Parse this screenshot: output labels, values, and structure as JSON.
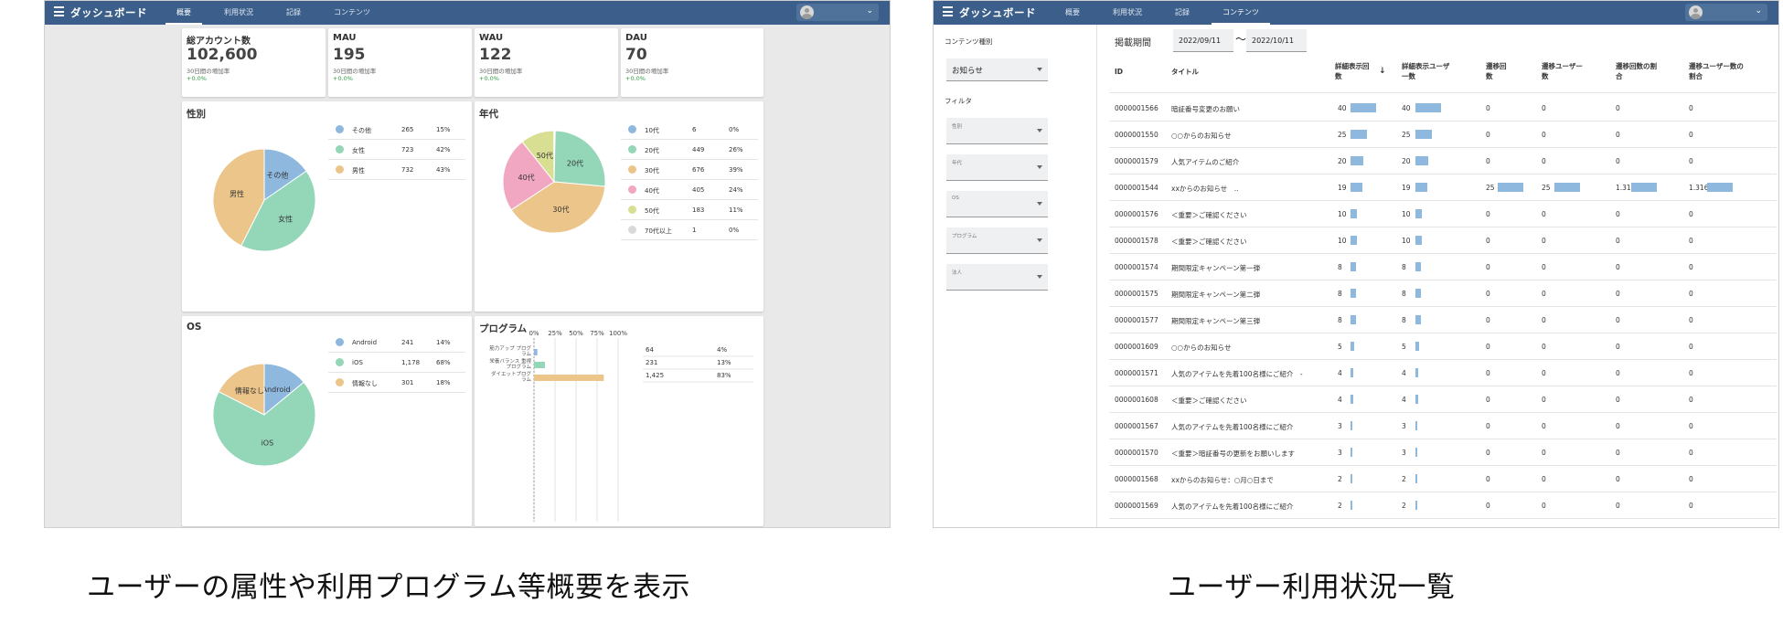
{
  "left_screen": {
    "brand": "ダッシュボード",
    "tabs": [
      "概要",
      "利用状況",
      "記録",
      "コンテンツ"
    ],
    "active_tab": 0,
    "stats": [
      {
        "label": "総アカウント数",
        "value": "102,600",
        "sub": "30日間の増加率",
        "change": "+0.0%"
      },
      {
        "label": "MAU",
        "value": "195",
        "sub": "30日間の増加率",
        "change": "+0.0%"
      },
      {
        "label": "WAU",
        "value": "122",
        "sub": "30日間の増加率",
        "change": "+0.0%"
      },
      {
        "label": "DAU",
        "value": "70",
        "sub": "30日間の増加率",
        "change": "+0.0%"
      }
    ],
    "gender": {
      "title": "性別",
      "items": [
        {
          "name": "その他",
          "count": "265",
          "pct": "15%",
          "value": 265,
          "color": "#8fb8df"
        },
        {
          "name": "女性",
          "count": "723",
          "pct": "42%",
          "value": 723,
          "color": "#93d7b8"
        },
        {
          "name": "男性",
          "count": "732",
          "pct": "43%",
          "value": 732,
          "color": "#ecc58a"
        }
      ]
    },
    "age": {
      "title": "年代",
      "items": [
        {
          "name": "10代",
          "count": "6",
          "pct": "0%",
          "value": 6,
          "color": "#8fb8df",
          "slice_label": ""
        },
        {
          "name": "20代",
          "count": "449",
          "pct": "26%",
          "value": 449,
          "color": "#93d7b8",
          "slice_label": "20代"
        },
        {
          "name": "30代",
          "count": "676",
          "pct": "39%",
          "value": 676,
          "color": "#ecc58a",
          "slice_label": "30代"
        },
        {
          "name": "40代",
          "count": "405",
          "pct": "24%",
          "value": 405,
          "color": "#f1a7c2",
          "slice_label": "40代"
        },
        {
          "name": "50代",
          "count": "183",
          "pct": "11%",
          "value": 183,
          "color": "#d8df92",
          "slice_label": "50代"
        },
        {
          "name": "70代以上",
          "count": "1",
          "pct": "0%",
          "value": 1,
          "color": "#d9d9d9",
          "slice_label": ""
        }
      ]
    },
    "os": {
      "title": "OS",
      "items": [
        {
          "name": "Android",
          "count": "241",
          "pct": "14%",
          "value": 241,
          "color": "#8fb8df"
        },
        {
          "name": "iOS",
          "count": "1,178",
          "pct": "68%",
          "value": 1178,
          "color": "#93d7b8"
        },
        {
          "name": "情報なし",
          "count": "301",
          "pct": "18%",
          "value": 301,
          "color": "#ecc58a"
        }
      ]
    },
    "program": {
      "title": "プログラム",
      "ticks": [
        "0%",
        "25%",
        "50%",
        "75%",
        "100%"
      ],
      "items": [
        {
          "name_lines": [
            "筋力アップ プログ",
            "ラム"
          ],
          "count": "64",
          "pct": "4%",
          "value": 0.04,
          "color": "#8fb8df"
        },
        {
          "name_lines": [
            "栄養バランス 重視",
            "プログラム"
          ],
          "count": "231",
          "pct": "13%",
          "value": 0.13,
          "color": "#93d7b8"
        },
        {
          "name_lines": [
            "ダイエットプログ",
            "ラム"
          ],
          "count": "1,425",
          "pct": "83%",
          "value": 0.83,
          "color": "#ecc58a"
        }
      ]
    }
  },
  "right_screen": {
    "brand": "ダッシュボード",
    "tabs": [
      "概要",
      "利用状況",
      "記録",
      "コンテンツ"
    ],
    "active_tab": 3,
    "content_type_label": "コンテンツ種別",
    "content_type_value": "お知らせ",
    "filter_label": "フィルタ",
    "filters": [
      "性別",
      "年代",
      "OS",
      "プログラム",
      "法人"
    ],
    "period_label": "掲載期間",
    "date_from": "2022/09/11",
    "date_to": "2022/10/11",
    "tilde": "〜",
    "sort_icon": "↓",
    "headers": [
      [
        "ID"
      ],
      [
        "タイトル"
      ],
      [
        "詳細表示回",
        "数"
      ],
      [
        "詳細表示ユーザ",
        "一数"
      ],
      [
        "遷移回",
        "数"
      ],
      [
        "遷移ユーザー",
        "数"
      ],
      [
        "遷移回数の割",
        "合"
      ],
      [
        "遷移ユーザー数の",
        "割合"
      ]
    ],
    "rows": [
      {
        "id": "0000001566",
        "title": "暗証番号変更のお願い",
        "views": 40,
        "users": 40,
        "tr": "0",
        "tru": "0",
        "rate": "0",
        "urate": "0"
      },
      {
        "id": "0000001550",
        "title": "○○からのお知らせ",
        "views": 25,
        "users": 25,
        "tr": "0",
        "tru": "0",
        "rate": "0",
        "urate": "0"
      },
      {
        "id": "0000001579",
        "title": "人気アイテムのご紹介",
        "views": 20,
        "users": 20,
        "tr": "0",
        "tru": "0",
        "rate": "0",
        "urate": "0"
      },
      {
        "id": "0000001544",
        "title": "xxからのお知らせ　..",
        "views": 19,
        "users": 19,
        "tr": "25",
        "tru": "25",
        "rate": "1.31",
        "urate": "1.316"
      },
      {
        "id": "0000001576",
        "title": "＜重要＞ご確認ください",
        "views": 10,
        "users": 10,
        "tr": "0",
        "tru": "0",
        "rate": "0",
        "urate": "0"
      },
      {
        "id": "0000001578",
        "title": "＜重要＞ご確認ください",
        "views": 10,
        "users": 10,
        "tr": "0",
        "tru": "0",
        "rate": "0",
        "urate": "0"
      },
      {
        "id": "0000001574",
        "title": "期間限定キャンペーン第一弾",
        "views": 8,
        "users": 8,
        "tr": "0",
        "tru": "0",
        "rate": "0",
        "urate": "0"
      },
      {
        "id": "0000001575",
        "title": "期間限定キャンペーン第二弾",
        "views": 8,
        "users": 8,
        "tr": "0",
        "tru": "0",
        "rate": "0",
        "urate": "0"
      },
      {
        "id": "0000001577",
        "title": "期間限定キャンペーン第三弾",
        "views": 8,
        "users": 8,
        "tr": "0",
        "tru": "0",
        "rate": "0",
        "urate": "0"
      },
      {
        "id": "0000001609",
        "title": "○○からのお知らせ",
        "views": 5,
        "users": 5,
        "tr": "0",
        "tru": "0",
        "rate": "0",
        "urate": "0"
      },
      {
        "id": "0000001571",
        "title": "人気のアイテムを先着100名様にご紹介　-",
        "views": 4,
        "users": 4,
        "tr": "0",
        "tru": "0",
        "rate": "0",
        "urate": "0"
      },
      {
        "id": "0000001608",
        "title": "＜重要＞ご確認ください",
        "views": 4,
        "users": 4,
        "tr": "0",
        "tru": "0",
        "rate": "0",
        "urate": "0"
      },
      {
        "id": "0000001567",
        "title": "人気のアイテムを先着100名様にご紹介",
        "views": 3,
        "users": 3,
        "tr": "0",
        "tru": "0",
        "rate": "0",
        "urate": "0"
      },
      {
        "id": "0000001570",
        "title": "＜重要＞暗証番号の更新をお願いします",
        "views": 3,
        "users": 3,
        "tr": "0",
        "tru": "0",
        "rate": "0",
        "urate": "0"
      },
      {
        "id": "0000001568",
        "title": "xxからのお知らせ：○月○日まで",
        "views": 2,
        "users": 2,
        "tr": "0",
        "tru": "0",
        "rate": "0",
        "urate": "0"
      },
      {
        "id": "0000001569",
        "title": "人気のアイテムを先着100名様にご紹介",
        "views": 2,
        "users": 2,
        "tr": "0",
        "tru": "0",
        "rate": "0",
        "urate": "0"
      }
    ]
  },
  "captions": {
    "left": "ユーザーの属性や利用プログラム等概要を表示",
    "right": "ユーザー利用状況一覧"
  },
  "colors": {
    "topbar": "#3b5f8a",
    "bar": "#8fb8df",
    "positive": "#2e9e46"
  }
}
